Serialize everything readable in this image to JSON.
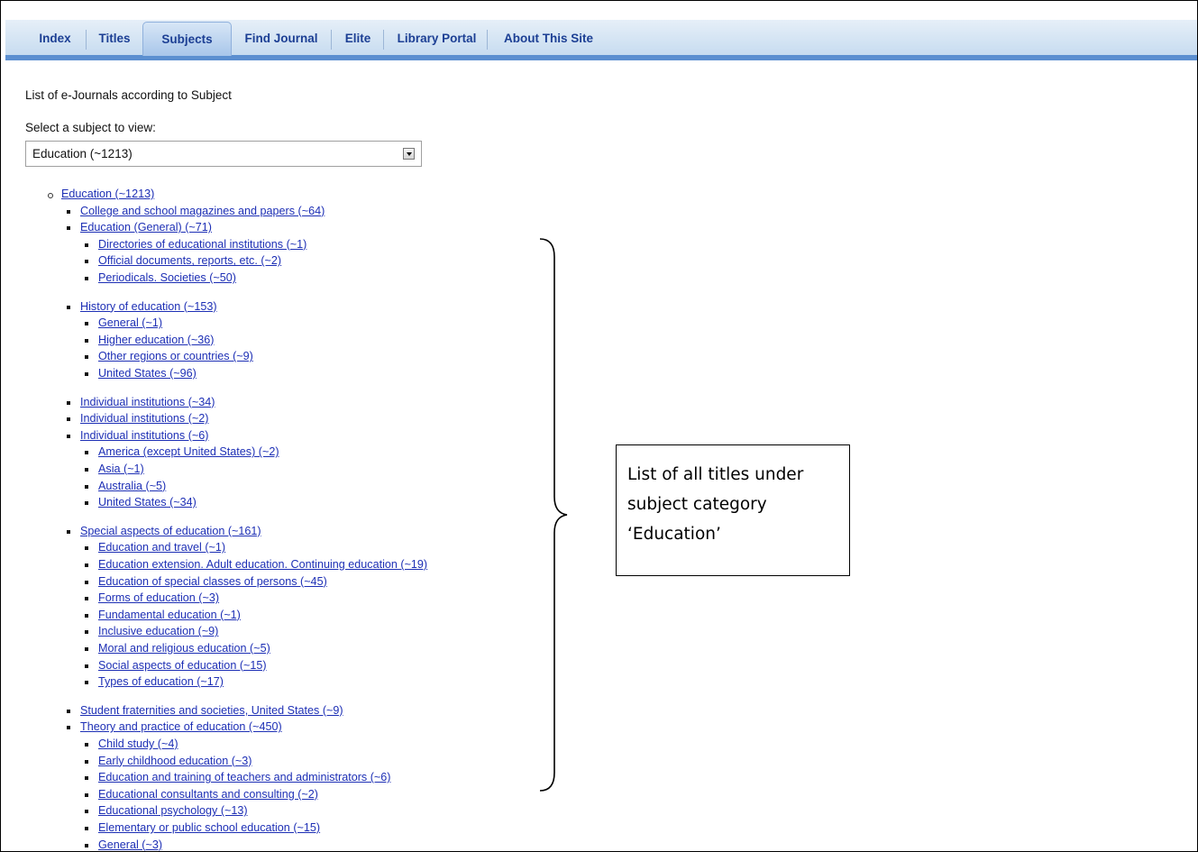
{
  "nav": {
    "tabs": [
      {
        "label": "Index"
      },
      {
        "label": "Titles"
      },
      {
        "label": "Subjects",
        "active": true
      },
      {
        "label": "Find Journal"
      },
      {
        "label": "Elite"
      },
      {
        "label": "Library Portal"
      },
      {
        "label": "About This Site"
      }
    ]
  },
  "main": {
    "heading": "List of e-Journals according to Subject",
    "select_label": "Select a subject to view:",
    "select_value": "Education (~1213)"
  },
  "tree": [
    {
      "label": "Education (~1213)",
      "level": 0
    },
    {
      "label": "College and school magazines and papers (~64)",
      "level": 1
    },
    {
      "label": "Education (General) (~71)",
      "level": 1
    },
    {
      "label": "Directories of educational institutions (~1)",
      "level": 2
    },
    {
      "label": "Official documents, reports, etc. (~2)",
      "level": 2
    },
    {
      "label": "Periodicals. Societies (~50)",
      "level": 2
    },
    {
      "label": "History of education (~153)",
      "level": 1
    },
    {
      "label": "General (~1)",
      "level": 2
    },
    {
      "label": "Higher education (~36)",
      "level": 2
    },
    {
      "label": "Other regions or countries (~9)",
      "level": 2
    },
    {
      "label": "United States (~96)",
      "level": 2
    },
    {
      "label": "Individual institutions (~34)",
      "level": 1
    },
    {
      "label": "Individual institutions (~2)",
      "level": 1
    },
    {
      "label": "Individual institutions (~6)",
      "level": 1
    },
    {
      "label": "America (except United States) (~2)",
      "level": 2
    },
    {
      "label": "Asia (~1)",
      "level": 2
    },
    {
      "label": "Australia (~5)",
      "level": 2
    },
    {
      "label": "United States (~34)",
      "level": 2
    },
    {
      "label": "Special aspects of education (~161)",
      "level": 1
    },
    {
      "label": "Education and travel (~1)",
      "level": 2
    },
    {
      "label": "Education extension. Adult education. Continuing education (~19)",
      "level": 2
    },
    {
      "label": "Education of special classes of persons (~45)",
      "level": 2
    },
    {
      "label": "Forms of education (~3)",
      "level": 2
    },
    {
      "label": "Fundamental education (~1)",
      "level": 2
    },
    {
      "label": "Inclusive education (~9)",
      "level": 2
    },
    {
      "label": "Moral and religious education (~5)",
      "level": 2
    },
    {
      "label": "Social aspects of education (~15)",
      "level": 2
    },
    {
      "label": "Types of education (~17)",
      "level": 2
    },
    {
      "label": "Student fraternities and societies, United States (~9)",
      "level": 1
    },
    {
      "label": "Theory and practice of education (~450)",
      "level": 1
    },
    {
      "label": "Child study (~4)",
      "level": 2
    },
    {
      "label": "Early childhood education (~3)",
      "level": 2
    },
    {
      "label": "Education and training of teachers and administrators (~6)",
      "level": 2
    },
    {
      "label": "Educational consultants and consulting (~2)",
      "level": 2
    },
    {
      "label": "Educational psychology (~13)",
      "level": 2
    },
    {
      "label": "Elementary or public school education (~15)",
      "level": 2
    },
    {
      "label": "General (~3)",
      "level": 2
    }
  ],
  "annotation": {
    "text": "List of all titles under subject category ‘Education’"
  }
}
